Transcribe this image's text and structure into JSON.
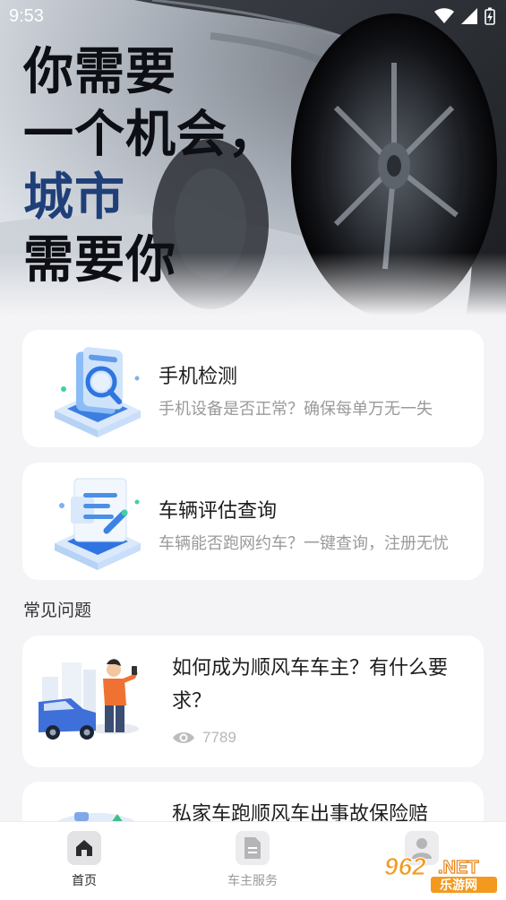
{
  "status_bar": {
    "time": "9:53"
  },
  "hero": {
    "slogan_lines": [
      "你需要",
      "一个机会，",
      "城市",
      "需要你"
    ]
  },
  "services": [
    {
      "title": "手机检测",
      "desc": "手机设备是否正常？确保每单万无一失",
      "icon": "phone-check-icon"
    },
    {
      "title": "车辆评估查询",
      "desc": "车辆能否跑网约车？一键查询，注册无忧",
      "icon": "vehicle-document-icon"
    }
  ],
  "faq": {
    "section_title": "常见问题",
    "items": [
      {
        "question": "如何成为顺风车车主？有什么要求？",
        "views": "7789"
      },
      {
        "question": "私家车跑顺风车出事故保险赔"
      }
    ]
  },
  "tabbar": {
    "items": [
      {
        "label": "首页",
        "icon": "home-icon",
        "active": true
      },
      {
        "label": "车主服务",
        "icon": "document-icon",
        "active": false
      },
      {
        "label": "",
        "icon": "profile-icon",
        "active": false
      }
    ]
  },
  "watermark": {
    "brand": "962.NET",
    "sub": "乐游网"
  },
  "colors": {
    "accent_blue": "#1f3f78",
    "active_tab": "#2b2b2b",
    "inactive_tab": "#9a9a9a"
  }
}
